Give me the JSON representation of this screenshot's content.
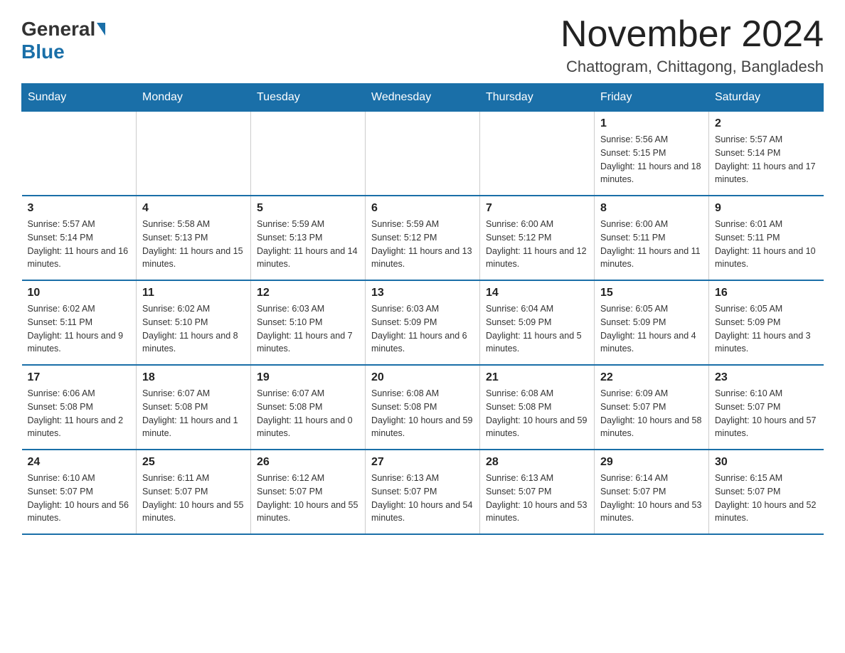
{
  "logo": {
    "general": "General",
    "blue": "Blue"
  },
  "title": "November 2024",
  "subtitle": "Chattogram, Chittagong, Bangladesh",
  "weekdays": [
    "Sunday",
    "Monday",
    "Tuesday",
    "Wednesday",
    "Thursday",
    "Friday",
    "Saturday"
  ],
  "weeks": [
    [
      {
        "day": "",
        "sunrise": "",
        "sunset": "",
        "daylight": ""
      },
      {
        "day": "",
        "sunrise": "",
        "sunset": "",
        "daylight": ""
      },
      {
        "day": "",
        "sunrise": "",
        "sunset": "",
        "daylight": ""
      },
      {
        "day": "",
        "sunrise": "",
        "sunset": "",
        "daylight": ""
      },
      {
        "day": "",
        "sunrise": "",
        "sunset": "",
        "daylight": ""
      },
      {
        "day": "1",
        "sunrise": "Sunrise: 5:56 AM",
        "sunset": "Sunset: 5:15 PM",
        "daylight": "Daylight: 11 hours and 18 minutes."
      },
      {
        "day": "2",
        "sunrise": "Sunrise: 5:57 AM",
        "sunset": "Sunset: 5:14 PM",
        "daylight": "Daylight: 11 hours and 17 minutes."
      }
    ],
    [
      {
        "day": "3",
        "sunrise": "Sunrise: 5:57 AM",
        "sunset": "Sunset: 5:14 PM",
        "daylight": "Daylight: 11 hours and 16 minutes."
      },
      {
        "day": "4",
        "sunrise": "Sunrise: 5:58 AM",
        "sunset": "Sunset: 5:13 PM",
        "daylight": "Daylight: 11 hours and 15 minutes."
      },
      {
        "day": "5",
        "sunrise": "Sunrise: 5:59 AM",
        "sunset": "Sunset: 5:13 PM",
        "daylight": "Daylight: 11 hours and 14 minutes."
      },
      {
        "day": "6",
        "sunrise": "Sunrise: 5:59 AM",
        "sunset": "Sunset: 5:12 PM",
        "daylight": "Daylight: 11 hours and 13 minutes."
      },
      {
        "day": "7",
        "sunrise": "Sunrise: 6:00 AM",
        "sunset": "Sunset: 5:12 PM",
        "daylight": "Daylight: 11 hours and 12 minutes."
      },
      {
        "day": "8",
        "sunrise": "Sunrise: 6:00 AM",
        "sunset": "Sunset: 5:11 PM",
        "daylight": "Daylight: 11 hours and 11 minutes."
      },
      {
        "day": "9",
        "sunrise": "Sunrise: 6:01 AM",
        "sunset": "Sunset: 5:11 PM",
        "daylight": "Daylight: 11 hours and 10 minutes."
      }
    ],
    [
      {
        "day": "10",
        "sunrise": "Sunrise: 6:02 AM",
        "sunset": "Sunset: 5:11 PM",
        "daylight": "Daylight: 11 hours and 9 minutes."
      },
      {
        "day": "11",
        "sunrise": "Sunrise: 6:02 AM",
        "sunset": "Sunset: 5:10 PM",
        "daylight": "Daylight: 11 hours and 8 minutes."
      },
      {
        "day": "12",
        "sunrise": "Sunrise: 6:03 AM",
        "sunset": "Sunset: 5:10 PM",
        "daylight": "Daylight: 11 hours and 7 minutes."
      },
      {
        "day": "13",
        "sunrise": "Sunrise: 6:03 AM",
        "sunset": "Sunset: 5:09 PM",
        "daylight": "Daylight: 11 hours and 6 minutes."
      },
      {
        "day": "14",
        "sunrise": "Sunrise: 6:04 AM",
        "sunset": "Sunset: 5:09 PM",
        "daylight": "Daylight: 11 hours and 5 minutes."
      },
      {
        "day": "15",
        "sunrise": "Sunrise: 6:05 AM",
        "sunset": "Sunset: 5:09 PM",
        "daylight": "Daylight: 11 hours and 4 minutes."
      },
      {
        "day": "16",
        "sunrise": "Sunrise: 6:05 AM",
        "sunset": "Sunset: 5:09 PM",
        "daylight": "Daylight: 11 hours and 3 minutes."
      }
    ],
    [
      {
        "day": "17",
        "sunrise": "Sunrise: 6:06 AM",
        "sunset": "Sunset: 5:08 PM",
        "daylight": "Daylight: 11 hours and 2 minutes."
      },
      {
        "day": "18",
        "sunrise": "Sunrise: 6:07 AM",
        "sunset": "Sunset: 5:08 PM",
        "daylight": "Daylight: 11 hours and 1 minute."
      },
      {
        "day": "19",
        "sunrise": "Sunrise: 6:07 AM",
        "sunset": "Sunset: 5:08 PM",
        "daylight": "Daylight: 11 hours and 0 minutes."
      },
      {
        "day": "20",
        "sunrise": "Sunrise: 6:08 AM",
        "sunset": "Sunset: 5:08 PM",
        "daylight": "Daylight: 10 hours and 59 minutes."
      },
      {
        "day": "21",
        "sunrise": "Sunrise: 6:08 AM",
        "sunset": "Sunset: 5:08 PM",
        "daylight": "Daylight: 10 hours and 59 minutes."
      },
      {
        "day": "22",
        "sunrise": "Sunrise: 6:09 AM",
        "sunset": "Sunset: 5:07 PM",
        "daylight": "Daylight: 10 hours and 58 minutes."
      },
      {
        "day": "23",
        "sunrise": "Sunrise: 6:10 AM",
        "sunset": "Sunset: 5:07 PM",
        "daylight": "Daylight: 10 hours and 57 minutes."
      }
    ],
    [
      {
        "day": "24",
        "sunrise": "Sunrise: 6:10 AM",
        "sunset": "Sunset: 5:07 PM",
        "daylight": "Daylight: 10 hours and 56 minutes."
      },
      {
        "day": "25",
        "sunrise": "Sunrise: 6:11 AM",
        "sunset": "Sunset: 5:07 PM",
        "daylight": "Daylight: 10 hours and 55 minutes."
      },
      {
        "day": "26",
        "sunrise": "Sunrise: 6:12 AM",
        "sunset": "Sunset: 5:07 PM",
        "daylight": "Daylight: 10 hours and 55 minutes."
      },
      {
        "day": "27",
        "sunrise": "Sunrise: 6:13 AM",
        "sunset": "Sunset: 5:07 PM",
        "daylight": "Daylight: 10 hours and 54 minutes."
      },
      {
        "day": "28",
        "sunrise": "Sunrise: 6:13 AM",
        "sunset": "Sunset: 5:07 PM",
        "daylight": "Daylight: 10 hours and 53 minutes."
      },
      {
        "day": "29",
        "sunrise": "Sunrise: 6:14 AM",
        "sunset": "Sunset: 5:07 PM",
        "daylight": "Daylight: 10 hours and 53 minutes."
      },
      {
        "day": "30",
        "sunrise": "Sunrise: 6:15 AM",
        "sunset": "Sunset: 5:07 PM",
        "daylight": "Daylight: 10 hours and 52 minutes."
      }
    ]
  ]
}
